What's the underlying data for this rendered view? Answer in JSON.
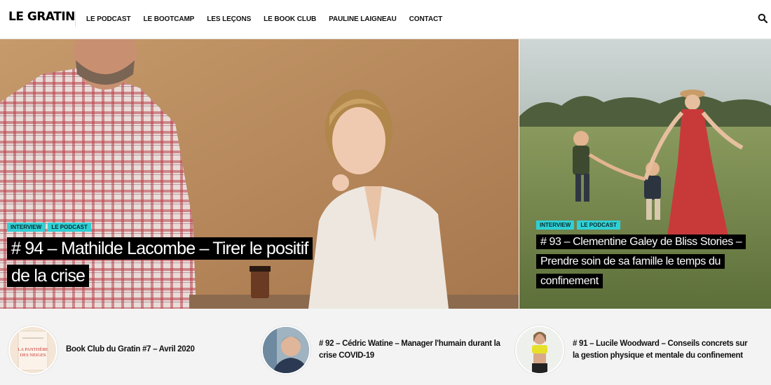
{
  "header": {
    "logo": "LE GRATIN",
    "nav": [
      "LE PODCAST",
      "LE BOOTCAMP",
      "LES LEÇONS",
      "LE BOOK CLUB",
      "PAULINE LAIGNEAU",
      "CONTACT"
    ],
    "search_icon": "search-icon"
  },
  "hero": {
    "main": {
      "tags": [
        "INTERVIEW",
        "LE PODCAST"
      ],
      "title": "# 94 – Mathilde Lacombe – Tirer le positif de la crise"
    },
    "side": {
      "tags": [
        "INTERVIEW",
        "LE PODCAST"
      ],
      "title": "# 93 – Clementine Galey de Bliss Stories – Prendre soin de sa famille le temps du confinement"
    }
  },
  "recent": [
    {
      "title": "Book Club du Gratin #7 – Avril 2020",
      "thumb_text": "LA PANTHÈRE DES NEIGES"
    },
    {
      "title": "# 92 – Cédric Watine – Manager l'humain durant la crise COVID-19"
    },
    {
      "title": "# 91 – Lucile Woodward – Conseils concrets sur la gestion physique et mentale du confinement"
    }
  ],
  "colors": {
    "tag_bg": "#2fd0d5",
    "title_bg": "#000000",
    "strip_bg": "#f3f3f3"
  }
}
